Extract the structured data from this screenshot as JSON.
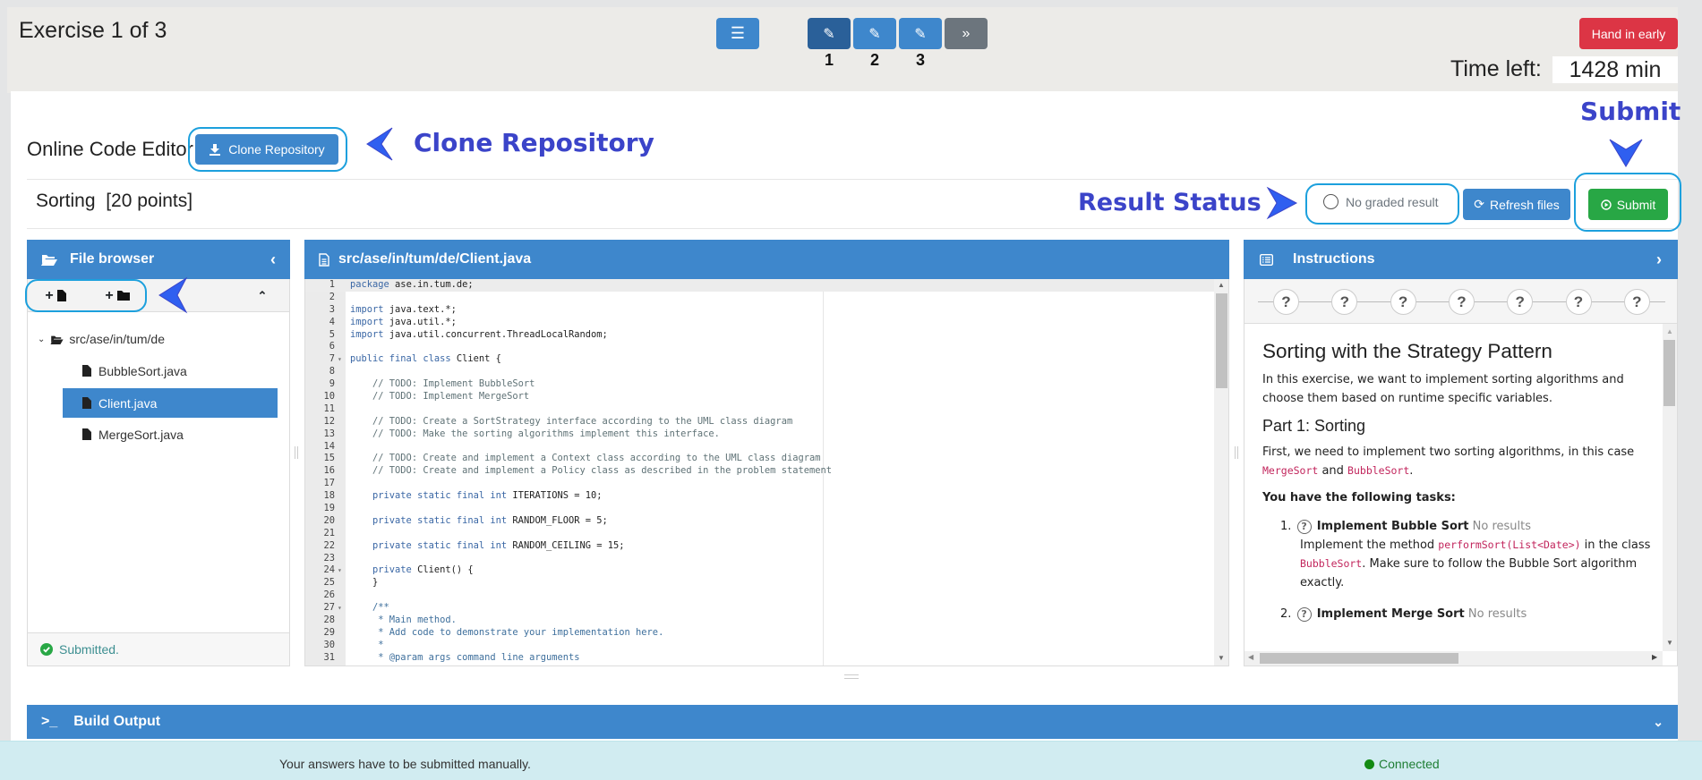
{
  "header": {
    "exercise_title": "Exercise 1 of 3",
    "exercise_nav": [
      {
        "number": "1",
        "icon": "edit-icon",
        "active": true
      },
      {
        "number": "2",
        "icon": "edit-icon",
        "active": false
      },
      {
        "number": "3",
        "icon": "edit-icon",
        "active": false
      }
    ],
    "menu_icon": "☰",
    "edit_icon": "✎",
    "next_icon": "»",
    "hand_in_label": "Hand in early",
    "time_left_label": "Time left:",
    "time_left_value": "1428 min"
  },
  "editor_header": {
    "title": "Online Code Editor",
    "clone_label": "Clone Repository",
    "exercise_name": "Sorting  [20 points]",
    "result_status": "No graded result",
    "refresh_label": "Refresh files",
    "submit_label": "Submit"
  },
  "annotations": {
    "clone": "Clone Repository",
    "result_status": "Result Status",
    "submit": "Submit"
  },
  "file_browser": {
    "title": "File browser",
    "folder": "src/ase/in/tum/de",
    "files": [
      {
        "name": "BubbleSort.java",
        "active": false
      },
      {
        "name": "Client.java",
        "active": true
      },
      {
        "name": "MergeSort.java",
        "active": false
      }
    ],
    "status": "Submitted."
  },
  "editor": {
    "file_path": "src/ase/in/tum/de/Client.java",
    "lines": [
      {
        "n": "1",
        "fold": false,
        "parts": [
          [
            "kw",
            "package"
          ],
          [
            "",
            " ase.in.tum.de;"
          ]
        ]
      },
      {
        "n": "2",
        "fold": false,
        "parts": []
      },
      {
        "n": "3",
        "fold": false,
        "parts": [
          [
            "kw",
            "import"
          ],
          [
            "",
            " java.text.*;"
          ]
        ]
      },
      {
        "n": "4",
        "fold": false,
        "parts": [
          [
            "kw",
            "import"
          ],
          [
            "",
            " java.util.*;"
          ]
        ]
      },
      {
        "n": "5",
        "fold": false,
        "parts": [
          [
            "kw",
            "import"
          ],
          [
            "",
            " java.util.concurrent.ThreadLocalRandom;"
          ]
        ]
      },
      {
        "n": "6",
        "fold": false,
        "parts": []
      },
      {
        "n": "7",
        "fold": true,
        "parts": [
          [
            "kw",
            "public final class"
          ],
          [
            "",
            " Client {"
          ]
        ]
      },
      {
        "n": "8",
        "fold": false,
        "parts": []
      },
      {
        "n": "9",
        "fold": false,
        "parts": [
          [
            "cm",
            "    // TODO: Implement BubbleSort"
          ]
        ]
      },
      {
        "n": "10",
        "fold": false,
        "parts": [
          [
            "cm",
            "    // TODO: Implement MergeSort"
          ]
        ]
      },
      {
        "n": "11",
        "fold": false,
        "parts": []
      },
      {
        "n": "12",
        "fold": false,
        "parts": [
          [
            "cm",
            "    // TODO: Create a SortStrategy interface according to the UML class diagram"
          ]
        ]
      },
      {
        "n": "13",
        "fold": false,
        "parts": [
          [
            "cm",
            "    // TODO: Make the sorting algorithms implement this interface."
          ]
        ]
      },
      {
        "n": "14",
        "fold": false,
        "parts": []
      },
      {
        "n": "15",
        "fold": false,
        "parts": [
          [
            "cm",
            "    // TODO: Create and implement a Context class according to the UML class diagram"
          ]
        ]
      },
      {
        "n": "16",
        "fold": false,
        "parts": [
          [
            "cm",
            "    // TODO: Create and implement a Policy class as described in the problem statement"
          ]
        ]
      },
      {
        "n": "17",
        "fold": false,
        "parts": []
      },
      {
        "n": "18",
        "fold": false,
        "parts": [
          [
            "kw",
            "    private static final int"
          ],
          [
            "",
            " ITERATIONS = 10;"
          ]
        ]
      },
      {
        "n": "19",
        "fold": false,
        "parts": []
      },
      {
        "n": "20",
        "fold": false,
        "parts": [
          [
            "kw",
            "    private static final int"
          ],
          [
            "",
            " RANDOM_FLOOR = 5;"
          ]
        ]
      },
      {
        "n": "21",
        "fold": false,
        "parts": []
      },
      {
        "n": "22",
        "fold": false,
        "parts": [
          [
            "kw",
            "    private static final int"
          ],
          [
            "",
            " RANDOM_CEILING = 15;"
          ]
        ]
      },
      {
        "n": "23",
        "fold": false,
        "parts": []
      },
      {
        "n": "24",
        "fold": true,
        "parts": [
          [
            "kw",
            "    private"
          ],
          [
            "",
            " Client() {"
          ]
        ]
      },
      {
        "n": "25",
        "fold": false,
        "parts": [
          [
            "",
            "    }"
          ]
        ]
      },
      {
        "n": "26",
        "fold": false,
        "parts": []
      },
      {
        "n": "27",
        "fold": true,
        "parts": [
          [
            "doc",
            "    /**"
          ]
        ]
      },
      {
        "n": "28",
        "fold": false,
        "parts": [
          [
            "doc",
            "     * Main method."
          ]
        ]
      },
      {
        "n": "29",
        "fold": false,
        "parts": [
          [
            "doc",
            "     * Add code to demonstrate your implementation here."
          ]
        ]
      },
      {
        "n": "30",
        "fold": false,
        "parts": [
          [
            "doc",
            "     *"
          ]
        ]
      },
      {
        "n": "31",
        "fold": false,
        "parts": [
          [
            "doc",
            "     * @param args command line arguments"
          ]
        ]
      }
    ]
  },
  "instructions": {
    "title": "Instructions",
    "step_count": 7,
    "step_glyph": "?",
    "heading": "Sorting with the Strategy Pattern",
    "intro": "In this exercise, we want to implement sorting algorithms and choose them based on runtime specific variables.",
    "part1_heading": "Part 1: Sorting",
    "part1_text_a": "First, we need to implement two sorting algorithms, in this case ",
    "part1_code_a": "MergeSort",
    "part1_text_b": " and ",
    "part1_code_b": "BubbleSort",
    "part1_text_c": ".",
    "tasks_label": "You have the following tasks:",
    "tasks": [
      {
        "num": "1.",
        "title": "Implement Bubble Sort",
        "status": "No results",
        "desc_a": "Implement the method ",
        "desc_code_a": "performSort(List<Date>)",
        "desc_b": " in the class ",
        "desc_code_b": "BubbleSort",
        "desc_c": ". Make sure to follow the Bubble Sort algorithm exactly."
      },
      {
        "num": "2.",
        "title": "Implement Merge Sort",
        "status": "No results"
      }
    ]
  },
  "build_output": {
    "title": "Build Output"
  },
  "footer": {
    "message": "Your answers have to be submitted manually.",
    "connection": "Connected"
  }
}
